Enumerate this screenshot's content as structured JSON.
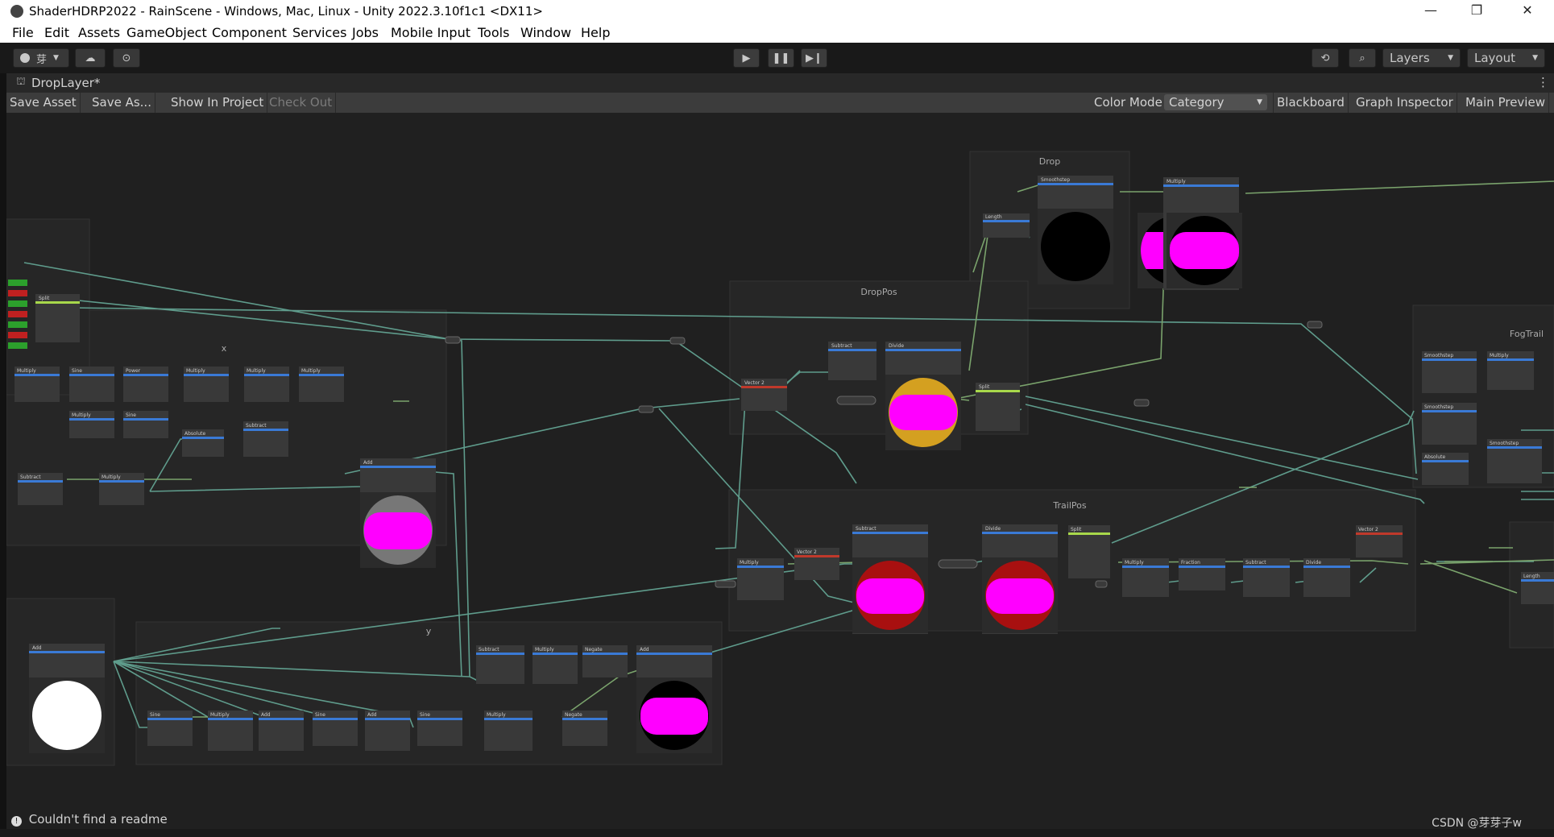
{
  "window": {
    "title": "ShaderHDRP2022 - RainScene - Windows, Mac, Linux - Unity 2022.3.10f1c1 <DX11>",
    "controls": [
      "—",
      "❐",
      "✕"
    ]
  },
  "menu": [
    "File",
    "Edit",
    "Assets",
    "GameObject",
    "Component",
    "Services",
    "Jobs",
    "Mobile Input",
    "Tools",
    "Window",
    "Help"
  ],
  "toolbar": {
    "account_label": "芽",
    "layers_label": "Layers",
    "layout_label": "Layout"
  },
  "tab": {
    "title": "DropLayer*"
  },
  "graph_toolbar": {
    "save_asset": "Save Asset",
    "save_as": "Save As...",
    "show_in_project": "Show In Project",
    "check_out": "Check Out",
    "color_mode_label": "Color Mode",
    "color_mode_value": "Category",
    "blackboard": "Blackboard",
    "graph_inspector": "Graph Inspector",
    "main_preview": "Main Preview"
  },
  "groups": {
    "drop": "Drop",
    "droppos": "DropPos",
    "fogtrail": "FogTrail",
    "x": "x",
    "trailpos": "TrailPos",
    "y": "y"
  },
  "nodes": {
    "split": "Split",
    "multiply": "Multiply",
    "sine": "Sine",
    "power": "Power",
    "subtract": "Subtract",
    "absolute": "Absolute",
    "add": "Add",
    "smoothstep": "Smoothstep",
    "length": "Length",
    "divide": "Divide",
    "vector2": "Vector 2",
    "fraction": "Fraction",
    "negate": "Negate"
  },
  "status": {
    "message": "Couldn't find a readme"
  },
  "watermark": "CSDN @芽芽子w",
  "colors": {
    "magenta": "#ff00ff",
    "header_blue": "#3a7ad6",
    "header_red": "#c0392b",
    "header_green": "#a8d84b",
    "wire": "#5f9c8c",
    "wire_green": "#7aa36c",
    "node_bg": "#393939",
    "group_bg": "#262626"
  }
}
